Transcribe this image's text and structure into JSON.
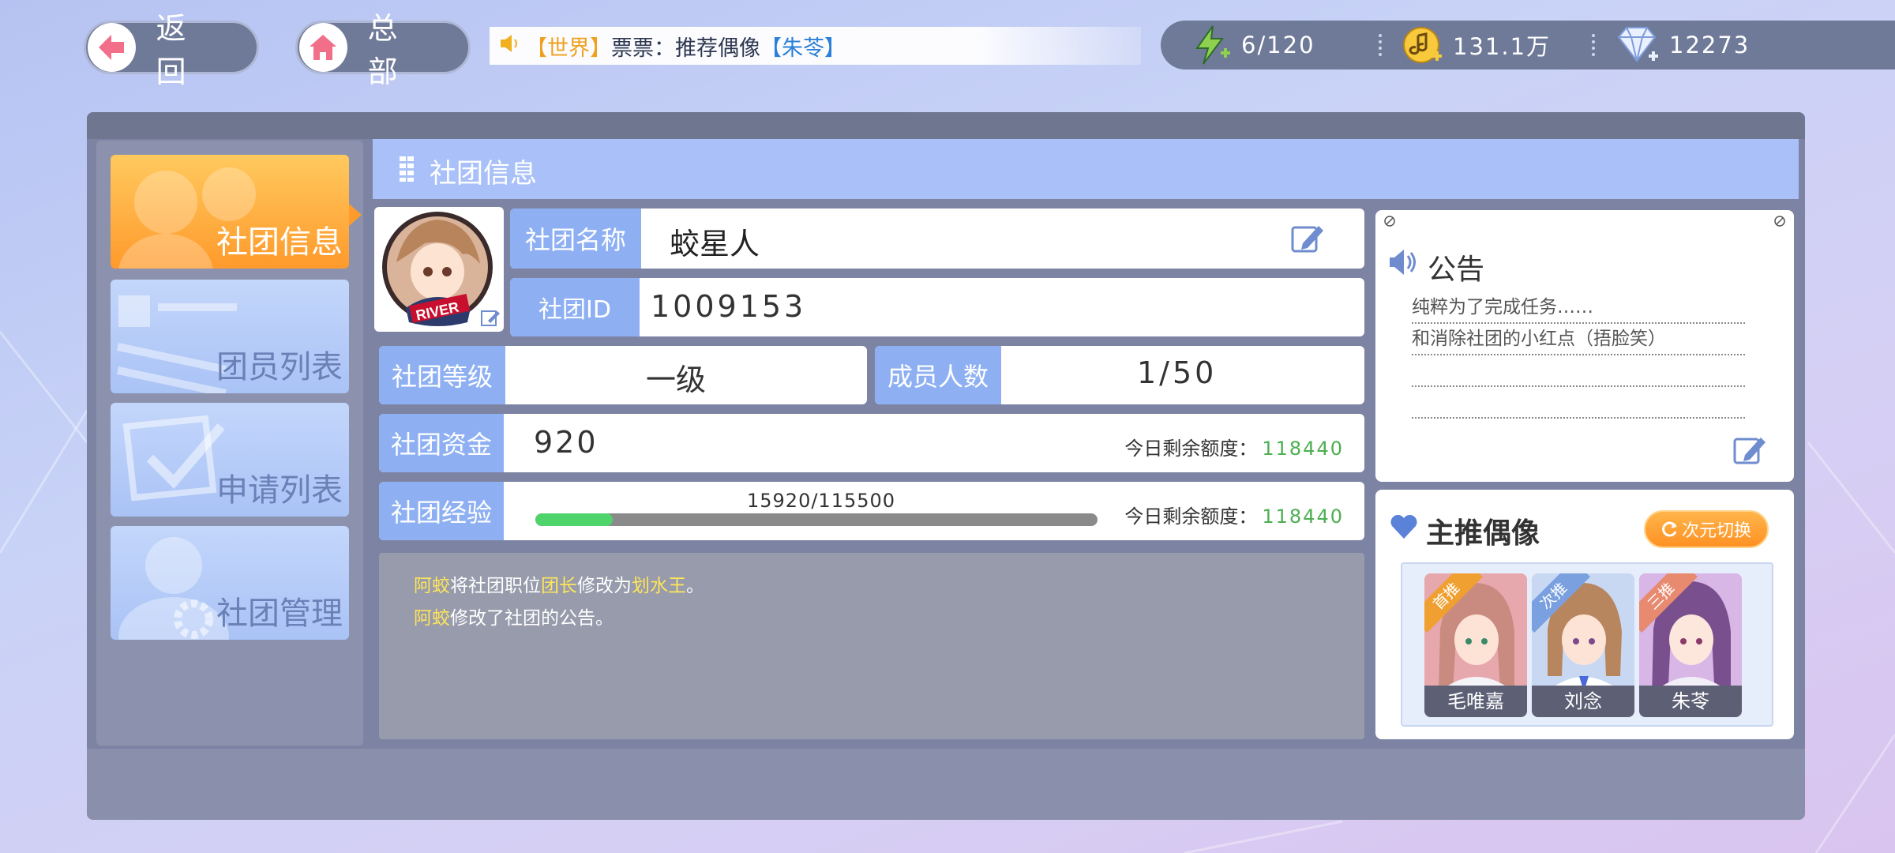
{
  "topbar": {
    "back_label": "返 回",
    "home_label": "总 部",
    "ticker": {
      "tag": "【世界】",
      "text": "票票：推荐偶像",
      "name": "【朱苓】"
    },
    "energy": "6/120",
    "coins": "131.1万",
    "diamonds": "12273"
  },
  "sidebar": {
    "items": [
      {
        "label": "社团信息",
        "active": true
      },
      {
        "label": "团员列表",
        "active": false
      },
      {
        "label": "申请列表",
        "active": false
      },
      {
        "label": "社团管理",
        "active": false
      }
    ]
  },
  "club": {
    "header_title": "社团信息",
    "name_label": "社团名称",
    "name": "蛟星人",
    "id_label": "社团ID",
    "id": "1009153",
    "level_label": "社团等级",
    "level": "一级",
    "members_label": "成员人数",
    "members": "1/50",
    "funds_label": "社团资金",
    "funds": "920",
    "funds_quota_label": "今日剩余额度：",
    "funds_quota": "118440",
    "exp_label": "社团经验",
    "exp_text": "15920/115500",
    "exp_progress": 0.138,
    "exp_quota_label": "今日剩余额度：",
    "exp_quota": "118440",
    "avatar_text": "RIVER"
  },
  "log": [
    {
      "actor": "阿蛟",
      "a": "将社团职位",
      "role": "团长",
      "b": "修改为",
      "new_role": "划水王",
      "c": "。"
    },
    {
      "actor": "阿蛟",
      "a": "修改了社团的公告。"
    }
  ],
  "notice": {
    "title": "公告",
    "lines": [
      "纯粹为了完成任务……",
      "和消除社团的小红点（捂脸笑）",
      "",
      ""
    ]
  },
  "idols": {
    "title": "主推偶像",
    "switch_label": "次元切换",
    "cards": [
      {
        "rank": "首推",
        "name": "毛唯嘉",
        "ribbon_color": "#f0a030",
        "bg": "#e7a8ad",
        "hair": "#c98a80"
      },
      {
        "rank": "次推",
        "name": "刘念",
        "ribbon_color": "#7aa0e0",
        "bg": "#c9d8f2",
        "hair": "#b8865e"
      },
      {
        "rank": "三推",
        "name": "朱苓",
        "ribbon_color": "#e88a70",
        "bg": "#d8b6e6",
        "hair": "#7a4f8e"
      }
    ]
  },
  "colors": {
    "accent_orange": "#ff9a2c",
    "label_blue": "#8eb0f3",
    "quota_green": "#4caf50",
    "log_yellow": "#ffe65a"
  }
}
